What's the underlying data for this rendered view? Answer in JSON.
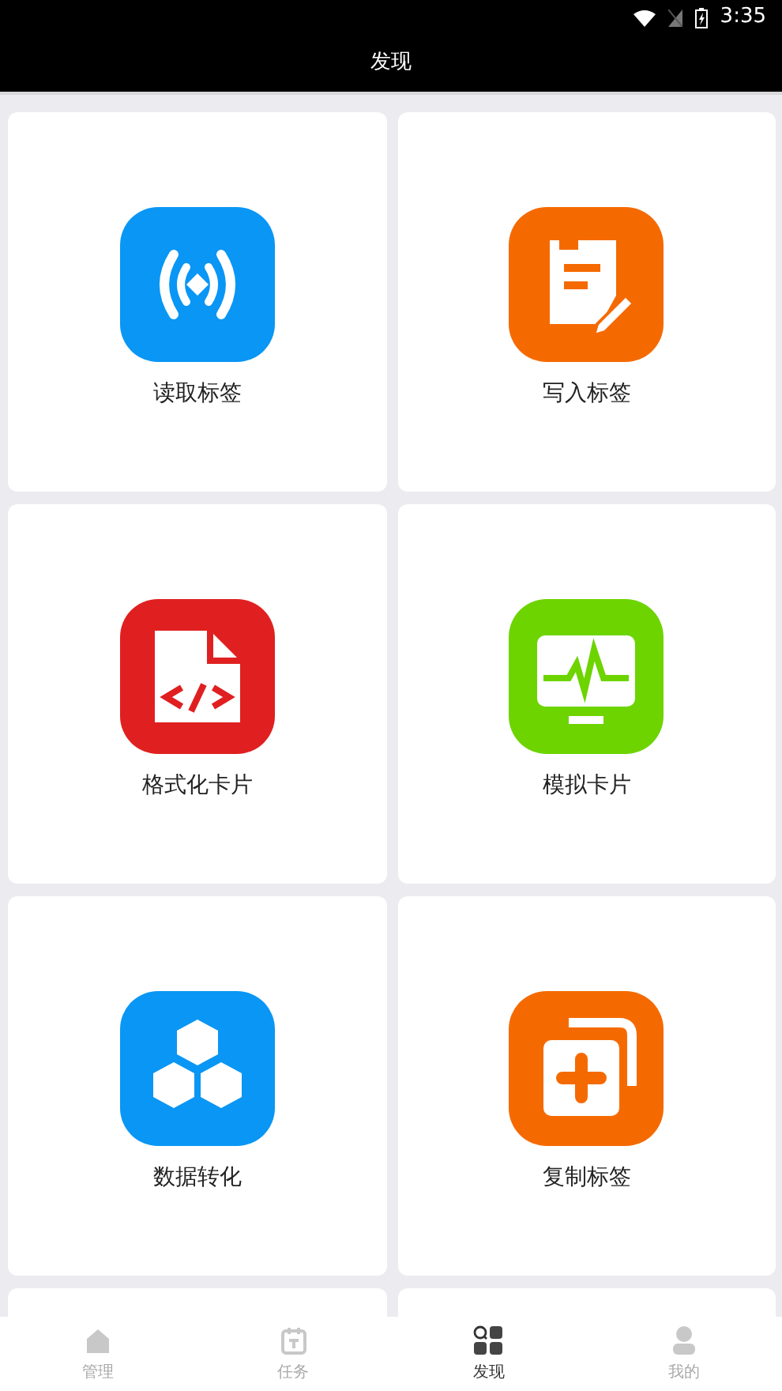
{
  "status_bar": {
    "time": "3:35"
  },
  "header": {
    "title": "发现"
  },
  "tiles": [
    {
      "label": "读取标签",
      "kind": "signal",
      "color": "#0a96f5"
    },
    {
      "label": "写入标签",
      "kind": "note",
      "color": "#f56a00"
    },
    {
      "label": "格式化卡片",
      "kind": "code",
      "color": "#e02020"
    },
    {
      "label": "模拟卡片",
      "kind": "monitor",
      "color": "#6dd400"
    },
    {
      "label": "数据转化",
      "kind": "hexagons",
      "color": "#0a96f5"
    },
    {
      "label": "复制标签",
      "kind": "copy",
      "color": "#f56a00"
    }
  ],
  "bottom_nav": [
    {
      "label": "管理",
      "kind": "home",
      "selected": false
    },
    {
      "label": "任务",
      "kind": "task",
      "selected": false
    },
    {
      "label": "发现",
      "kind": "discover",
      "selected": true
    },
    {
      "label": "我的",
      "kind": "user",
      "selected": false
    }
  ]
}
